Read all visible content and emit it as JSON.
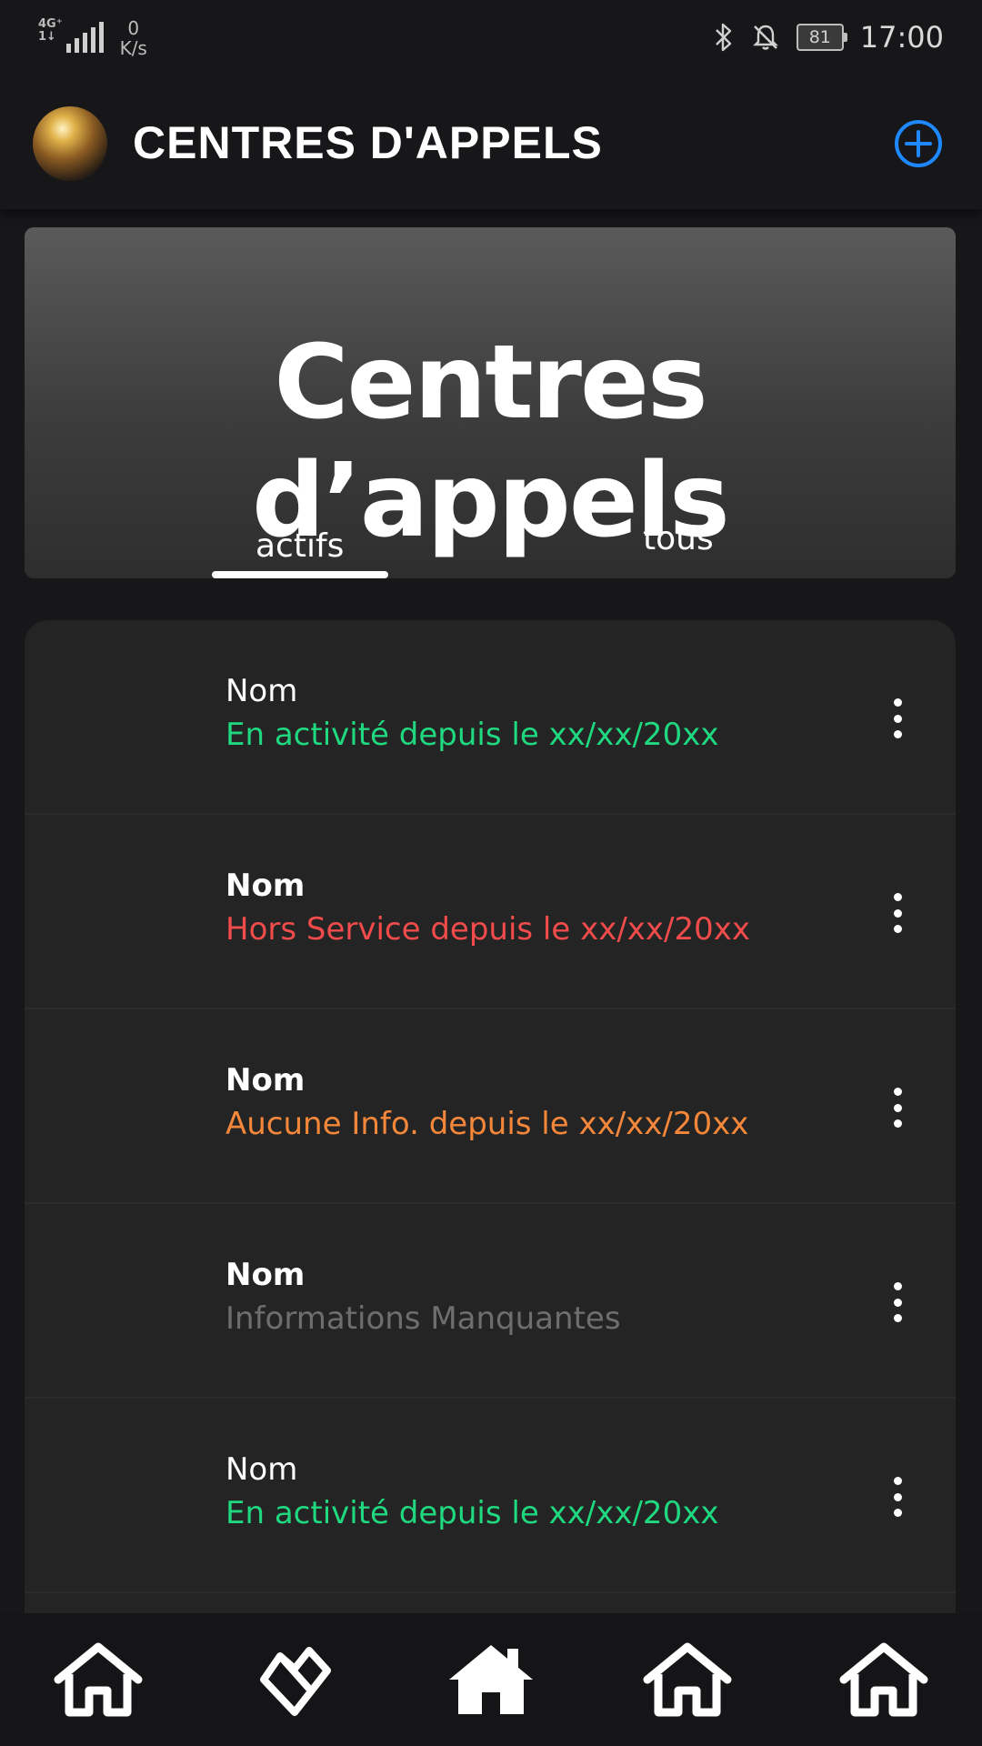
{
  "status_bar": {
    "network": "4G⁺",
    "network_sub": "1↓",
    "speed_value": "0",
    "speed_unit": "K/s",
    "battery": "81",
    "time": "17:00"
  },
  "header": {
    "title": "CENTRES D'APPELS",
    "add_icon": "plus-circle-icon",
    "accent_color": "#1e88ff"
  },
  "hero": {
    "title": "Centres d’appels",
    "tabs": [
      {
        "label": "actifs",
        "active": true
      },
      {
        "label": "tous",
        "active": false
      }
    ]
  },
  "list": {
    "items": [
      {
        "name": "Nom",
        "status": "En activité depuis le xx/xx/20xx",
        "status_color": "#1fd87f",
        "name_bold": false
      },
      {
        "name": "Nom",
        "status": "Hors Service depuis le xx/xx/20xx",
        "status_color": "#f24b4b",
        "name_bold": true
      },
      {
        "name": "Nom",
        "status": "Aucune Info. depuis le xx/xx/20xx",
        "status_color": "#f5873a",
        "name_bold": true
      },
      {
        "name": "Nom",
        "status": "Informations Manquantes",
        "status_color": "#6e6e6e",
        "name_bold": true
      },
      {
        "name": "Nom",
        "status": "En activité depuis le xx/xx/20xx",
        "status_color": "#1fd87f",
        "name_bold": false
      }
    ]
  },
  "bottom_nav": {
    "items": [
      {
        "icon": "home-outline-icon"
      },
      {
        "icon": "heart-diamond-icon"
      },
      {
        "icon": "home-filled-icon"
      },
      {
        "icon": "home-outline-icon"
      },
      {
        "icon": "home-outline-icon"
      }
    ]
  }
}
